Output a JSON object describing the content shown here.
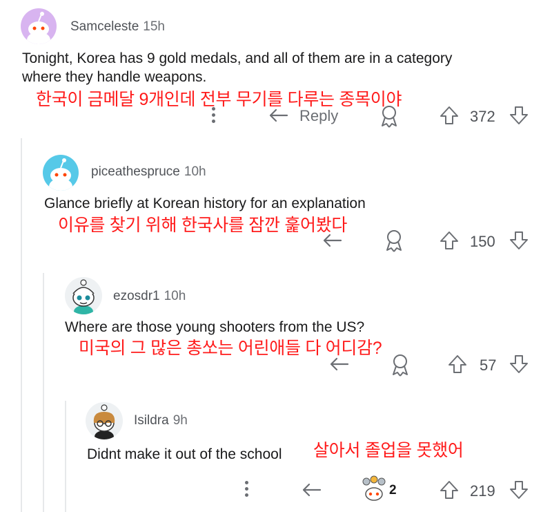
{
  "comments": [
    {
      "username": "Samceleste",
      "time": "15h",
      "text_line1": "Tonight, Korea has 9 gold medals, and all of them are in a category",
      "text_line2": "where they handle weapons.",
      "translation": "한국이 금메달 9개인데 전부 무기를 다루는 종목이야",
      "reply_label": "Reply",
      "votes": "372"
    },
    {
      "username": "piceathespruce",
      "time": "10h",
      "text_line1": "Glance briefly at Korean history for an explanation",
      "translation": "이유를 찾기 위해 한국사를 잠깐 훑어봤다",
      "votes": "150"
    },
    {
      "username": "ezosdr1",
      "time": "10h",
      "text_line1": "Where are those young shooters from the US?",
      "translation": "미국의 그 많은 총쏘는 어린애들 다 어디감?",
      "votes": "57"
    },
    {
      "username": "Isildra",
      "time": "9h",
      "text_line1": "Didnt make it out of the school",
      "translation": "살아서 졸업을 못했어",
      "award_count": "2",
      "votes": "219"
    }
  ],
  "colors": {
    "translation": "#ff1a1a",
    "avatar1_bg": "#d8b4f0",
    "avatar2_bg": "#56c9e8",
    "thread_line": "#e6e8ea"
  },
  "icons": [
    "more-options-icon",
    "reply-icon",
    "award-icon",
    "upvote-icon",
    "downvote-icon"
  ]
}
